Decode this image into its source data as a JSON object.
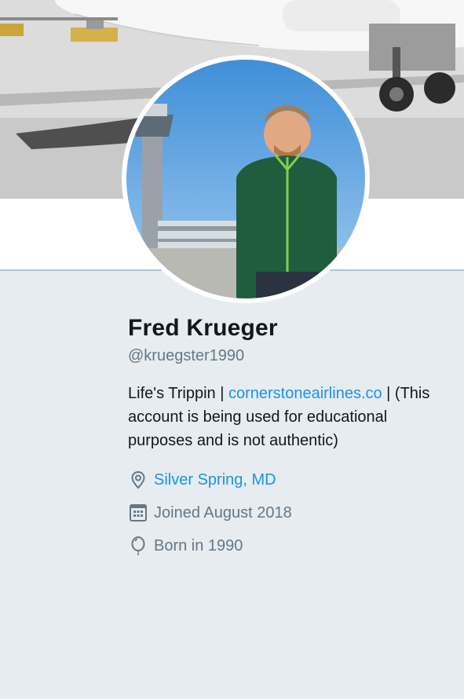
{
  "header": {
    "banner_image": "airplane-on-tarmac-photo"
  },
  "avatar": {
    "image": "man-in-green-jacket-at-airport-photo"
  },
  "profile": {
    "name": "Fred Krueger",
    "handle": "@kruegster1990",
    "bio": {
      "text_before": "Life's Trippin | ",
      "link_text": "cornerstoneairlines.co",
      "text_after": " | (This account is being used for educational purposes and is not authentic)"
    },
    "location": "Silver Spring, MD",
    "joined": "Joined August 2018",
    "birth": "Born in 1990"
  },
  "icons": {
    "location": "map-pin-icon",
    "joined": "calendar-icon",
    "birth": "balloon-icon"
  },
  "colors": {
    "link": "#1b95e0",
    "secondary_text": "#657786",
    "page_background": "#e6ecf0"
  }
}
